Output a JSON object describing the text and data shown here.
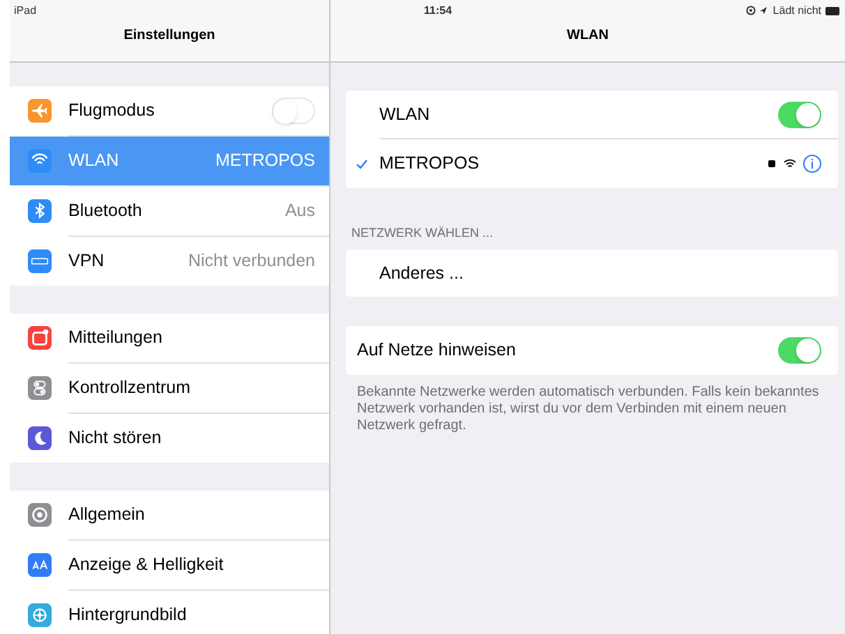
{
  "status_bar": {
    "device": "iPad",
    "time": "11:54",
    "battery_text": "Lädt nicht"
  },
  "sidebar": {
    "title": "Einstellungen",
    "groups": [
      [
        {
          "label": "Flugmodus",
          "color": "#f7962c",
          "kind": "toggle",
          "on": false,
          "selected": false
        },
        {
          "label": "WLAN",
          "value": "METROPOS",
          "color": "#2f8cf7",
          "kind": "value",
          "selected": true
        },
        {
          "label": "Bluetooth",
          "value": "Aus",
          "color": "#2f8cf7",
          "kind": "value",
          "selected": false
        },
        {
          "label": "VPN",
          "value": "Nicht verbunden",
          "color": "#2f8cf7",
          "kind": "value",
          "selected": false
        }
      ],
      [
        {
          "label": "Mitteilungen",
          "color": "#f5443f",
          "kind": "plain",
          "selected": false
        },
        {
          "label": "Kontrollzentrum",
          "color": "#8e8e93",
          "kind": "plain",
          "selected": false
        },
        {
          "label": "Nicht stören",
          "color": "#5d58d6",
          "kind": "plain",
          "selected": false
        }
      ],
      [
        {
          "label": "Allgemein",
          "color": "#8e8e93",
          "kind": "plain",
          "selected": false
        },
        {
          "label": "Anzeige & Helligkeit",
          "color": "#2f7cf6",
          "kind": "plain",
          "selected": false
        },
        {
          "label": "Hintergrundbild",
          "color": "#35aadc",
          "kind": "plain",
          "selected": false
        }
      ]
    ]
  },
  "detail": {
    "title": "WLAN",
    "wlan": {
      "label": "WLAN",
      "on": true
    },
    "current_network": {
      "name": "METROPOS",
      "connected": true
    },
    "section_header": "NETZWERK WÄHLEN ...",
    "other": "Anderes ...",
    "ask": {
      "label": "Auf Netze hinweisen",
      "on": true
    },
    "footer": "Bekannte Netzwerke werden automatisch verbunden. Falls kein bekanntes Netzwerk vorhanden ist, wirst du vor dem Verbinden mit einem neuen Netzwerk gefragt."
  }
}
